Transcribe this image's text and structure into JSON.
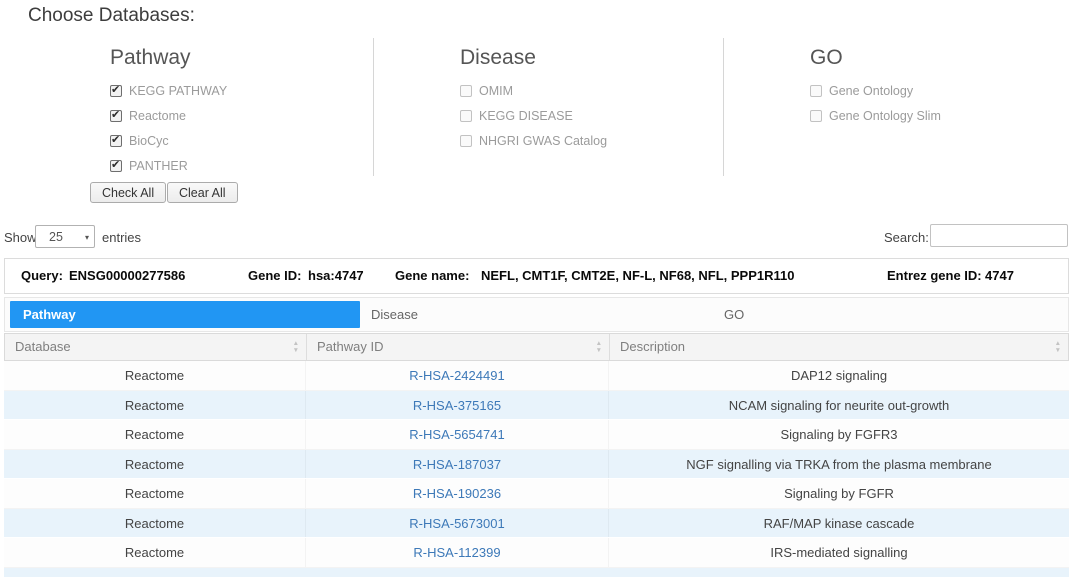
{
  "title": "Choose Databases:",
  "db_sections": [
    {
      "name": "Pathway",
      "items": [
        {
          "label": "KEGG PATHWAY",
          "checked": true
        },
        {
          "label": "Reactome",
          "checked": true
        },
        {
          "label": "BioCyc",
          "checked": true
        },
        {
          "label": "PANTHER",
          "checked": true
        }
      ]
    },
    {
      "name": "Disease",
      "items": [
        {
          "label": "OMIM",
          "checked": false
        },
        {
          "label": "KEGG DISEASE",
          "checked": false
        },
        {
          "label": "NHGRI GWAS Catalog",
          "checked": false
        }
      ]
    },
    {
      "name": "GO",
      "items": [
        {
          "label": "Gene Ontology",
          "checked": false
        },
        {
          "label": "Gene Ontology Slim",
          "checked": false
        }
      ]
    }
  ],
  "buttons": {
    "check_all": "Check All",
    "clear_all": "Clear All"
  },
  "length_control": {
    "show": "Show",
    "selected": "25",
    "entries": "entries",
    "arrow": "▾"
  },
  "search": {
    "label": "Search:",
    "value": ""
  },
  "query_bar": {
    "query_label": "Query:",
    "query_value": "ENSG00000277586",
    "gene_id_label": "Gene ID:",
    "gene_id_value": "hsa:4747",
    "gene_name_label": "Gene name:",
    "gene_name_value": "NEFL, CMT1F, CMT2E, NF-L, NF68, NFL, PPP1R110",
    "entrez_label": "Entrez gene ID:",
    "entrez_value": "4747"
  },
  "tabs": [
    {
      "label": "Pathway",
      "active": true
    },
    {
      "label": "Disease",
      "active": false
    },
    {
      "label": "GO",
      "active": false
    }
  ],
  "table": {
    "headers": [
      "Database",
      "Pathway ID",
      "Description"
    ],
    "rows": [
      {
        "database": "Reactome",
        "pathway_id": "R-HSA-2424491",
        "description": "DAP12 signaling"
      },
      {
        "database": "Reactome",
        "pathway_id": "R-HSA-375165",
        "description": "NCAM signaling for neurite out-growth"
      },
      {
        "database": "Reactome",
        "pathway_id": "R-HSA-5654741",
        "description": "Signaling by FGFR3"
      },
      {
        "database": "Reactome",
        "pathway_id": "R-HSA-187037",
        "description": "NGF signalling via TRKA from the plasma membrane"
      },
      {
        "database": "Reactome",
        "pathway_id": "R-HSA-190236",
        "description": "Signaling by FGFR"
      },
      {
        "database": "Reactome",
        "pathway_id": "R-HSA-5673001",
        "description": "RAF/MAP kinase cascade"
      },
      {
        "database": "Reactome",
        "pathway_id": "R-HSA-112399",
        "description": "IRS-mediated signalling"
      }
    ]
  },
  "colors": {
    "active_tab": "#2196f3",
    "link": "#3d79b8",
    "row_stripe": "#e8f3fb"
  }
}
